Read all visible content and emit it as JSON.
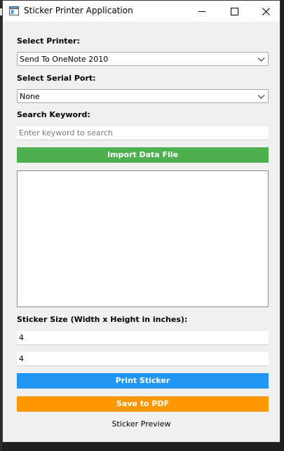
{
  "window": {
    "title": "Sticker Printer Application"
  },
  "printer": {
    "label": "Select Printer:",
    "selected": "Send To OneNote 2010"
  },
  "serial_port": {
    "label": "Select Serial Port:",
    "selected": "None"
  },
  "search": {
    "label": "Search Keyword:",
    "placeholder": "Enter keyword to search",
    "value": ""
  },
  "import_button": {
    "label": "Import Data File",
    "color": "#4caf50"
  },
  "sticker_size": {
    "label": "Sticker Size (Width x Height in inches):",
    "width": "4",
    "height": "4"
  },
  "print_button": {
    "label": "Print Sticker",
    "color": "#2196f3"
  },
  "pdf_button": {
    "label": "Save to PDF",
    "color": "#ff9800"
  },
  "preview": {
    "caption": "Sticker Preview"
  },
  "icons": [
    "app-icon",
    "minimize-icon",
    "maximize-icon",
    "close-icon",
    "chevron-down-icon"
  ]
}
